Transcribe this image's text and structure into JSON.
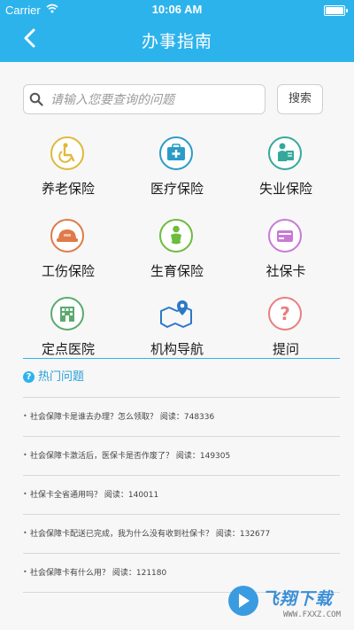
{
  "status_bar": {
    "carrier": "Carrier",
    "time": "10:06 AM"
  },
  "nav": {
    "title": "办事指南",
    "back_icon": "chevron-left-icon"
  },
  "search": {
    "placeholder": "请输入您要查询的问题",
    "value": "",
    "button_label": "搜索"
  },
  "services": [
    {
      "label": "养老保险",
      "icon": "wheelchair-icon",
      "color": "#e0b93a"
    },
    {
      "label": "医疗保险",
      "icon": "medical-kit-icon",
      "color": "#2b9cc8"
    },
    {
      "label": "失业保险",
      "icon": "person-sad-icon",
      "color": "#35a89b"
    },
    {
      "label": "工伤保险",
      "icon": "hardhat-icon",
      "color": "#e07a4a"
    },
    {
      "label": "生育保险",
      "icon": "baby-icon",
      "color": "#6cbc3e"
    },
    {
      "label": "社保卡",
      "icon": "card-icon",
      "color": "#c87ad8"
    },
    {
      "label": "定点医院",
      "icon": "hospital-building-icon",
      "color": "#5aaa6e"
    },
    {
      "label": "机构导航",
      "icon": "map-pin-icon",
      "color": "#2a78c8"
    },
    {
      "label": "提问",
      "icon": "question-icon",
      "color": "#e87f7f"
    }
  ],
  "hot": {
    "title": "热门问题",
    "questions": [
      {
        "text": "社会保障卡是谁去办理？怎么领取？ 阅读：748336"
      },
      {
        "text": "社会保障卡激活后，医保卡是否作废了？ 阅读：149305"
      },
      {
        "text": "社保卡全省通用吗？ 阅读：140011"
      },
      {
        "text": "社会保障卡配送已完成，我为什么没有收到社保卡？ 阅读：132677"
      },
      {
        "text": "社会保障卡有什么用？ 阅读：121180"
      }
    ]
  },
  "watermark": {
    "brand": "飞翔下载",
    "url": "WWW.FXXZ.COM"
  },
  "colors": {
    "primary": "#2db3ec",
    "background": "#f7f7f7"
  }
}
